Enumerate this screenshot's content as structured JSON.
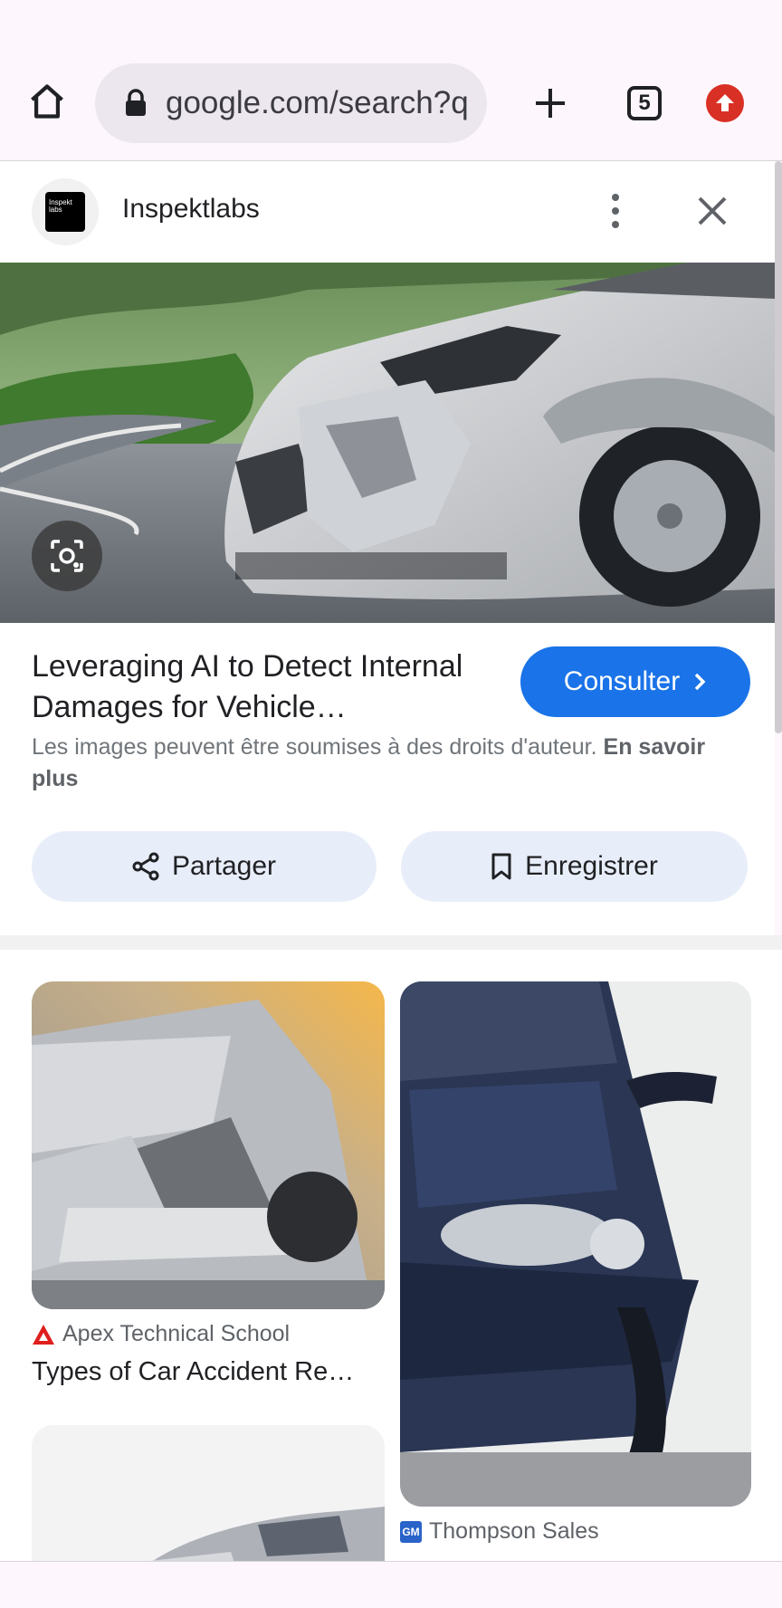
{
  "browser": {
    "url": "google.com/search?q",
    "tab_count": "5",
    "icons": [
      "home-icon",
      "lock-icon",
      "plus-icon",
      "tabs-icon",
      "update-icon"
    ]
  },
  "panel": {
    "source_name": "Inspektlabs",
    "logo_text": "Inspekt labs",
    "title": "Leveraging AI to Detect Internal Damages for Vehicle…",
    "visit_label": "Consulter",
    "copyright_text": "Les images peuvent être soumises à des droits d'auteur.",
    "learn_more": "En savoir plus",
    "share_label": "Partager",
    "save_label": "Enregistrer"
  },
  "results": [
    {
      "source": "Apex Technical School",
      "title": "Types of Car Accident Re…"
    },
    {
      "source": "Thompson Sales",
      "title": ""
    }
  ],
  "colors": {
    "accent": "#1a73e8",
    "update_badge": "#d93025",
    "chip_bg": "#e8eef9"
  }
}
